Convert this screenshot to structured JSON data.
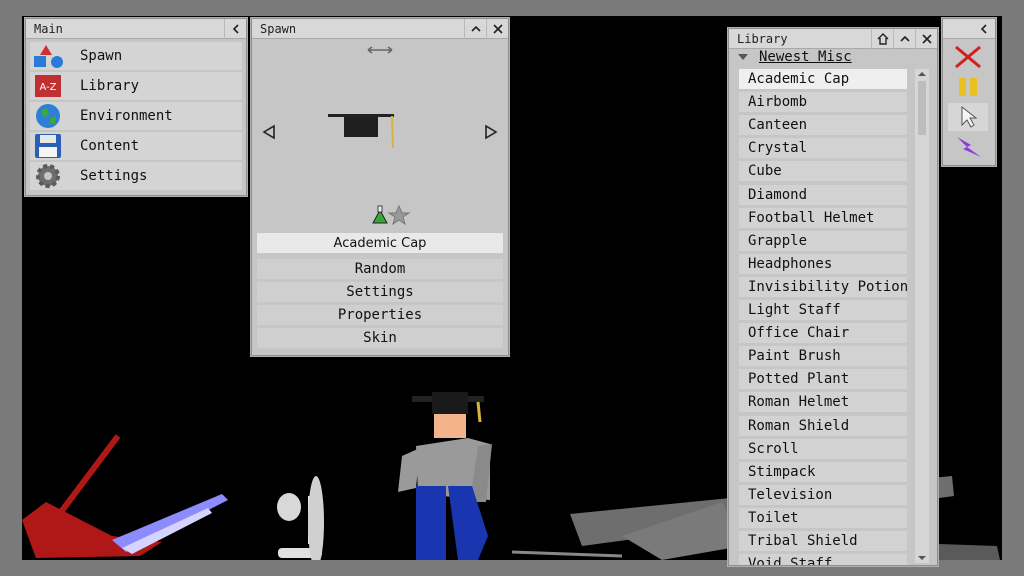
{
  "main": {
    "title": "Main",
    "collapse_icon": "chevron-left-icon",
    "items": [
      {
        "label": "Spawn",
        "icon": "shapes-icon"
      },
      {
        "label": "Library",
        "icon": "a-z-icon"
      },
      {
        "label": "Environment",
        "icon": "globe-icon"
      },
      {
        "label": "Content",
        "icon": "floppy-disk-icon"
      },
      {
        "label": "Settings",
        "icon": "gear-icon"
      }
    ]
  },
  "spawn": {
    "title": "Spawn",
    "selected_item": "Academic Cap",
    "buttons": [
      "Random",
      "Settings",
      "Properties",
      "Skin"
    ]
  },
  "library": {
    "title": "Library",
    "category": "Newest Misc",
    "selected": "Academic Cap",
    "items": [
      "Academic Cap",
      "Airbomb",
      "Canteen",
      "Crystal",
      "Cube",
      "Diamond",
      "Football Helmet",
      "Grapple",
      "Headphones",
      "Invisibility Potion",
      "Light Staff",
      "Office Chair",
      "Paint Brush",
      "Potted Plant",
      "Roman Helmet",
      "Roman Shield",
      "Scroll",
      "Stimpack",
      "Television",
      "Toilet",
      "Tribal Shield",
      "Void Staff"
    ]
  },
  "tools": {
    "items": [
      "delete-x-icon",
      "pause-icon",
      "cursor-icon",
      "lightning-icon"
    ]
  },
  "colors": {
    "panel_bg": "#c6c6c6",
    "scene_bg": "#000000",
    "border_gray": "#7a7a7a"
  }
}
